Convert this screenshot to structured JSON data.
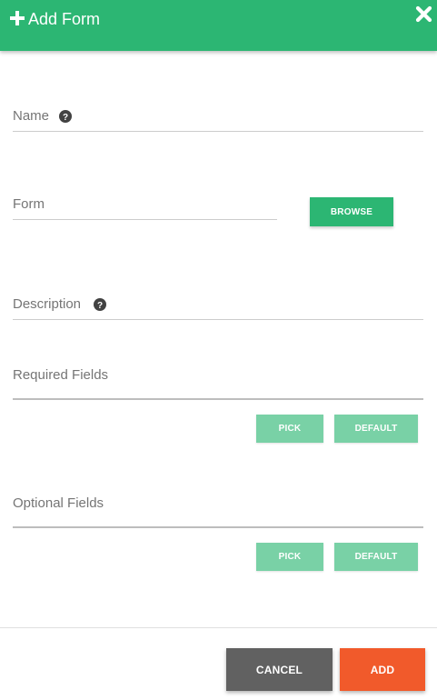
{
  "header": {
    "title": "Add Form",
    "plus_icon": "plus-icon",
    "close_icon": "close-icon"
  },
  "colors": {
    "accent": "#2cb673",
    "accent_light": "#79d1a6",
    "cancel": "#616161",
    "add": "#f15a2b"
  },
  "fields": {
    "name": {
      "label": "Name",
      "icon": "help-circle-icon"
    },
    "form": {
      "label": "Form",
      "browse_label": "BROWSE"
    },
    "description": {
      "label": "Description",
      "icon": "help-circle-icon"
    },
    "required_fields": {
      "label": "Required Fields",
      "pick_label": "PICK",
      "default_label": "DEFAULT"
    },
    "optional_fields": {
      "label": "Optional Fields",
      "pick_label": "PICK",
      "default_label": "DEFAULT"
    }
  },
  "footer": {
    "cancel_label": "CANCEL",
    "add_label": "ADD"
  }
}
